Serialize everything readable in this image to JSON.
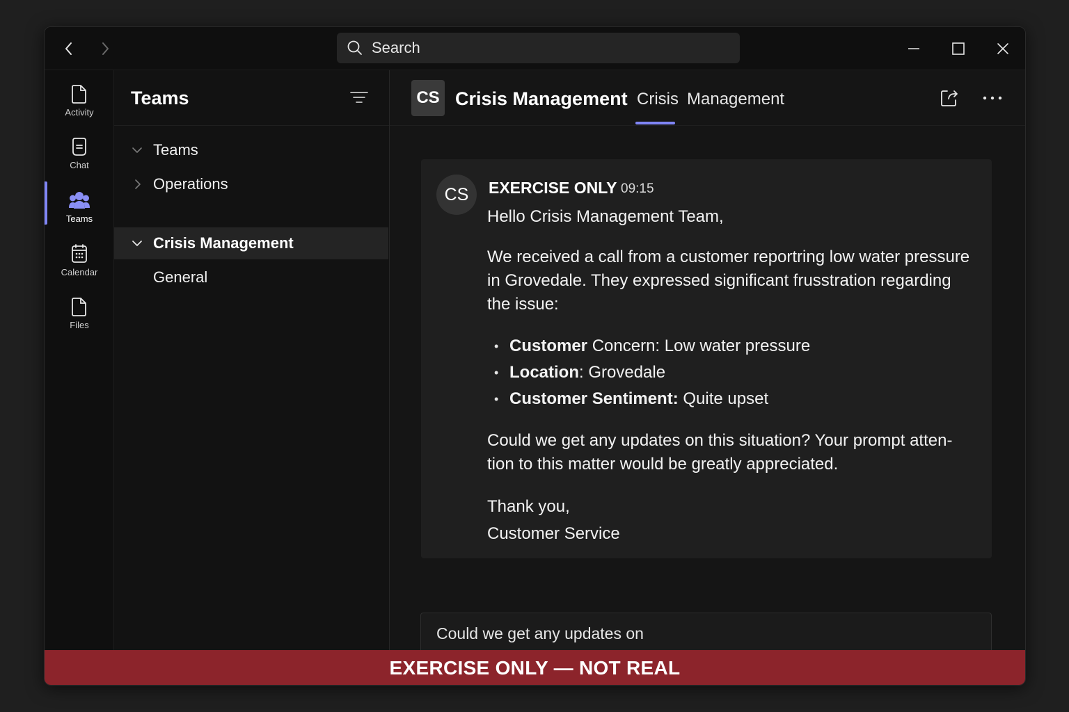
{
  "titlebar": {
    "search_placeholder": "Search"
  },
  "rail": {
    "items": [
      {
        "label": "Activity",
        "icon": "file-icon"
      },
      {
        "label": "Chat",
        "icon": "chat-icon"
      },
      {
        "label": "Teams",
        "icon": "teams-icon",
        "active": true
      },
      {
        "label": "Calendar",
        "icon": "calendar-icon"
      },
      {
        "label": "Files",
        "icon": "file-icon"
      }
    ]
  },
  "panel": {
    "title": "Teams",
    "tree": [
      {
        "label": "Teams",
        "chevron": "down"
      },
      {
        "label": "Operations",
        "chevron": "right"
      },
      {
        "label": "Crisis Management",
        "chevron": "down",
        "selected": true
      },
      {
        "label": "General"
      }
    ]
  },
  "channel": {
    "avatar": "CS",
    "title": "Crisis Management",
    "tabs": [
      "Crisis",
      "Management"
    ],
    "active_tab": "Crisis"
  },
  "message": {
    "avatar": "CS",
    "author": "EXERCISE ONLY",
    "time": "09:15",
    "greeting": "Hello Crisis Management Team,",
    "paragraph1": "We received a call from a customer reportring low water pressure in Grovedale. They expressed significant frusstration regarding the issue:",
    "bullets": [
      {
        "label": "Customer",
        "text": " Concern: Low water pressure"
      },
      {
        "label": "Location",
        "text": ": Grovedale"
      },
      {
        "label": "Customer Sentiment:",
        "text": " Quite upset"
      }
    ],
    "paragraph2": "Could we get any updates on this situation? Your prompt atten-tion to this matter would be greatly appreciated.",
    "signoff": "Thank you,",
    "signature": "Customer Service"
  },
  "compose": {
    "value": "Could we get any updates on"
  },
  "banner": {
    "text": "EXERCISE ONLY — NOT REAL",
    "color": "#8c242b"
  },
  "colors": {
    "accent": "#7f85f5",
    "background": "#0f0f0f"
  }
}
